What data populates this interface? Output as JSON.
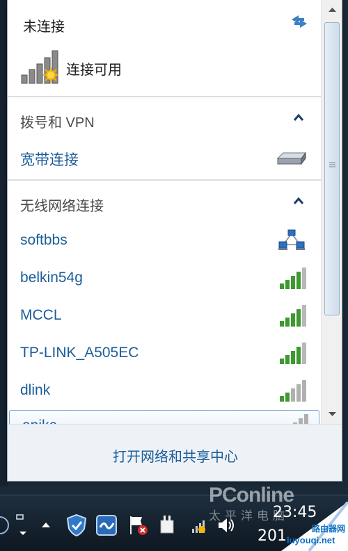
{
  "flyout": {
    "status_title": "未连接",
    "connection_status": "连接可用",
    "groups": {
      "dialup": {
        "title": "拨号和 VPN",
        "items": [
          {
            "name": "宽带连接",
            "icon": "modem-icon"
          }
        ]
      },
      "wireless": {
        "title": "无线网络连接",
        "items": [
          {
            "name": "softbbs",
            "icon": "adhoc-network-icon"
          },
          {
            "name": "belkin54g",
            "icon": "signal-bars-4-icon"
          },
          {
            "name": "MCCL",
            "icon": "signal-bars-4-icon"
          },
          {
            "name": "TP-LINK_A505EC",
            "icon": "signal-bars-4-icon"
          },
          {
            "name": "dlink",
            "icon": "signal-bars-2-icon"
          },
          {
            "name": "anike",
            "icon": "signal-bars-1-icon"
          }
        ]
      }
    },
    "footer_link": "打开网络和共享中心"
  },
  "taskbar": {
    "clock_time": "23:45",
    "clock_date": "201"
  },
  "watermarks": {
    "pconline": "PConline",
    "pconline_sub": "太平洋电脑",
    "site_name": "路由器网",
    "site_url": "luyouqi.net"
  },
  "colors": {
    "link_blue": "#1c5d99",
    "signal_green": "#3c9a2e",
    "signal_gray": "#a0a0a0",
    "footer_bg": "#eef2f7"
  }
}
